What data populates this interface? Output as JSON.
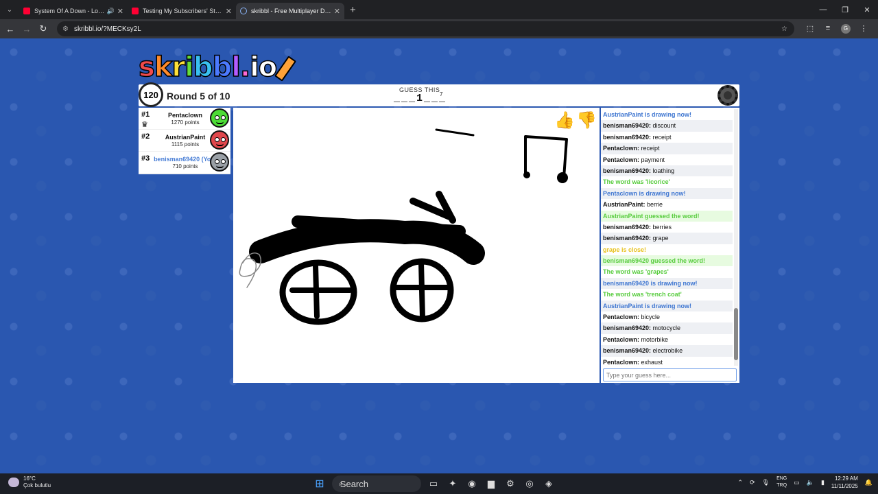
{
  "browser": {
    "tabs": [
      {
        "title": "System Of A Down - Lonely",
        "icon": "youtube-icon"
      },
      {
        "title": "Testing My Subscribers' Struggl",
        "icon": "youtube-icon"
      },
      {
        "title": "skribbl - Free Multiplayer Draw",
        "icon": "skribbl-icon"
      }
    ],
    "url": "skribbl.io/?MECKsy2L"
  },
  "game": {
    "logo": {
      "s": "s",
      "k": "k",
      "r": "r",
      "i": "i",
      "b": "b",
      "b2": "b",
      "l": "l",
      "dot": ".",
      "i2": "i",
      "o": "o"
    },
    "timer": "120",
    "round": "Round 5 of 10",
    "guess_label": "GUESS THIS",
    "word_hint": "___1___",
    "word_length": "7",
    "players": [
      {
        "rank": "#1",
        "name": "Pentaclown",
        "points": "1270 points",
        "self": false
      },
      {
        "rank": "#2",
        "name": "AustrianPaint",
        "points": "1115 points",
        "self": false
      },
      {
        "rank": "#3",
        "name": "benisman69420 (You)",
        "points": "710 points",
        "self": true
      }
    ],
    "chat": [
      {
        "type": "blue",
        "name": "",
        "text": "AustrianPaint is drawing now!"
      },
      {
        "type": "normal",
        "name": "benisman69420:",
        "text": " discount"
      },
      {
        "type": "normal",
        "name": "benisman69420:",
        "text": " receipt"
      },
      {
        "type": "normal",
        "name": "Pentaclown:",
        "text": " receipt"
      },
      {
        "type": "normal",
        "name": "Pentaclown:",
        "text": " payment"
      },
      {
        "type": "normal",
        "name": "benisman69420:",
        "text": " loathing"
      },
      {
        "type": "green",
        "name": "",
        "text": "The word was 'licorice'"
      },
      {
        "type": "blue",
        "name": "",
        "text": "Pentaclown is drawing now!"
      },
      {
        "type": "normal",
        "name": "AustrianPaint:",
        "text": " berrie"
      },
      {
        "type": "greenbg",
        "name": "",
        "text": "AustrianPaint guessed the word!"
      },
      {
        "type": "normal",
        "name": "benisman69420:",
        "text": " berries"
      },
      {
        "type": "normal",
        "name": "benisman69420:",
        "text": " grape"
      },
      {
        "type": "yellow",
        "name": "",
        "text": "grape is close!"
      },
      {
        "type": "greenbg",
        "name": "",
        "text": "benisman69420 guessed the word!"
      },
      {
        "type": "green",
        "name": "",
        "text": "The word was 'grapes'"
      },
      {
        "type": "blue",
        "name": "",
        "text": "benisman69420 is drawing now!"
      },
      {
        "type": "green",
        "name": "",
        "text": "The word was 'trench coat'"
      },
      {
        "type": "blue",
        "name": "",
        "text": "AustrianPaint is drawing now!"
      },
      {
        "type": "normal",
        "name": "Pentaclown:",
        "text": " bicycle"
      },
      {
        "type": "normal",
        "name": "benisman69420:",
        "text": " motocycle"
      },
      {
        "type": "normal",
        "name": "Pentaclown:",
        "text": " motorbike"
      },
      {
        "type": "normal",
        "name": "benisman69420:",
        "text": " electrobike"
      },
      {
        "type": "normal",
        "name": "Pentaclown:",
        "text": " exhaust"
      }
    ],
    "guess_placeholder": "Type your guess here..."
  },
  "taskbar": {
    "temperature": "16°C",
    "weather": "Çok bulutlu",
    "search": "Search",
    "lang1": "ENG",
    "lang2": "TRQ",
    "time": "12:29 AM",
    "date": "11/11/2025"
  },
  "colors": {
    "page_bg": "#2a57b0",
    "chat_blue": "#3e76d1",
    "chat_green": "#57cc3d",
    "chat_yellow": "#e8c21e"
  }
}
